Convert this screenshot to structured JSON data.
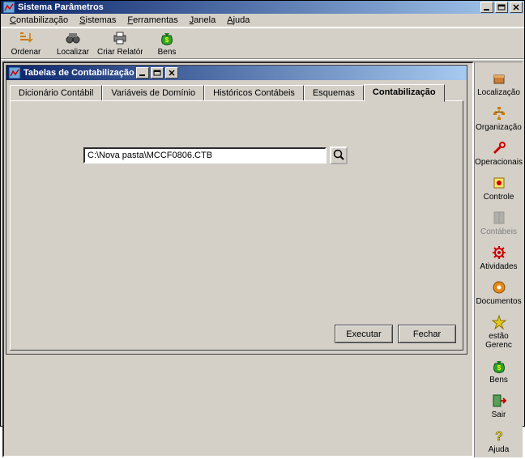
{
  "main_window": {
    "title": "Sistema Parâmetros"
  },
  "menubar": [
    "Contabilização",
    "Sistemas",
    "Ferramentas",
    "Janela",
    "Ajuda"
  ],
  "toolbar": {
    "ordenar": "Ordenar",
    "localizar": "Localizar",
    "criar_relatorio": "Criar Relatório",
    "bens": "Bens"
  },
  "child_window": {
    "title": "Tabelas de Contabilização",
    "tabs": [
      {
        "label": "Dicionário Contábil"
      },
      {
        "label": "Variáveis de Domínio"
      },
      {
        "label": "Históricos Contábeis"
      },
      {
        "label": "Esquemas"
      },
      {
        "label": "Contabilização"
      }
    ],
    "active_tab_index": 4,
    "path_value": "C:\\Nova pasta\\MCCF0806.CTB",
    "buttons": {
      "executar": "Executar",
      "fechar": "Fechar"
    }
  },
  "side_items": [
    {
      "label": "Localização",
      "dim": false,
      "icon": "box"
    },
    {
      "label": "Organização",
      "dim": false,
      "icon": "org"
    },
    {
      "label": "Operacionais",
      "dim": false,
      "icon": "tools"
    },
    {
      "label": "Controle",
      "dim": false,
      "icon": "control"
    },
    {
      "label": "Contábeis",
      "dim": true,
      "icon": "book"
    },
    {
      "label": "Atividades",
      "dim": false,
      "icon": "gear"
    },
    {
      "label": "Documentos",
      "dim": false,
      "icon": "docs"
    },
    {
      "label": "estão Gerenc",
      "dim": false,
      "icon": "star"
    },
    {
      "label": "Bens",
      "dim": false,
      "icon": "bag"
    },
    {
      "label": "Sair",
      "dim": false,
      "icon": "exit"
    },
    {
      "label": "Ajuda",
      "dim": false,
      "icon": "help"
    }
  ]
}
